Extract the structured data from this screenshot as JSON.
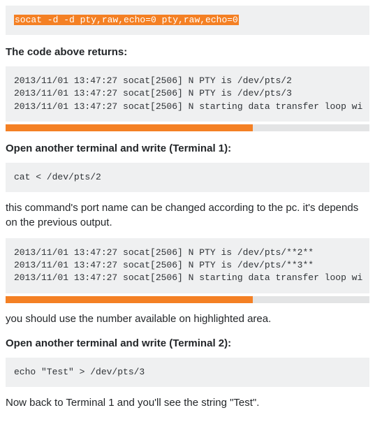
{
  "block1": {
    "code": "socat -d -d pty,raw,echo=0 pty,raw,echo=0"
  },
  "text1": "The code above returns:",
  "block2": {
    "line1": "2013/11/01 13:47:27 socat[2506] N PTY is /dev/pts/2",
    "line2": "2013/11/01 13:47:27 socat[2506] N PTY is /dev/pts/3",
    "line3": "2013/11/01 13:47:27 socat[2506] N starting data transfer loop wi"
  },
  "text2": "Open another terminal and write (Terminal 1):",
  "block3": {
    "code": "cat < /dev/pts/2"
  },
  "text3": "this command's port name can be changed according to the pc. it's depends on the previous output.",
  "block4": {
    "line1": "2013/11/01 13:47:27 socat[2506] N PTY is /dev/pts/**2**",
    "line2": "2013/11/01 13:47:27 socat[2506] N PTY is /dev/pts/**3**",
    "line3": "2013/11/01 13:47:27 socat[2506] N starting data transfer loop wi"
  },
  "text4": "you should use the number available on highlighted area.",
  "text5": "Open another terminal and write (Terminal 2):",
  "block5": {
    "code": "echo \"Test\" > /dev/pts/3"
  },
  "text6": "Now back to Terminal 1 and you'll see the string \"Test\"."
}
